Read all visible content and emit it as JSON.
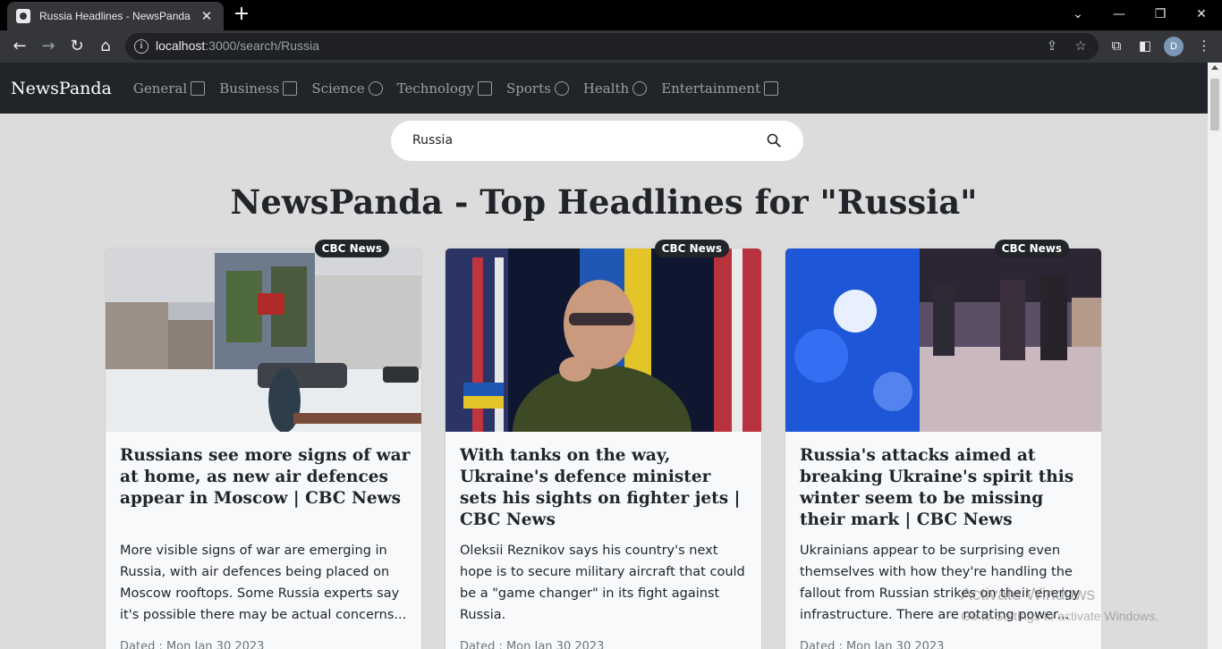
{
  "browser": {
    "tab_title": "Russia Headlines - NewsPanda",
    "url_host": "localhost",
    "url_rest": ":3000/search/Russia",
    "profile_initial": "D"
  },
  "navbar": {
    "brand": "NewsPanda",
    "links": [
      {
        "label": "General",
        "icon": "newspaper-icon"
      },
      {
        "label": "Business",
        "icon": "briefcase-icon"
      },
      {
        "label": "Science",
        "icon": "rocket-icon"
      },
      {
        "label": "Technology",
        "icon": "cpu-icon"
      },
      {
        "label": "Sports",
        "icon": "trophy-icon"
      },
      {
        "label": "Health",
        "icon": "lungs-icon"
      },
      {
        "label": "Entertainment",
        "icon": "film-icon"
      }
    ]
  },
  "search": {
    "value": "Russia",
    "icon": "search-icon"
  },
  "heading": "NewsPanda - Top Headlines for \"Russia\"",
  "cards": [
    {
      "source": "CBC News",
      "title": "Russians see more signs of war at home, as new air defences appear in Moscow | CBC News",
      "description": "More visible signs of war are emerging in Russia, with air defences being placed on Moscow rooftops. Some Russia experts say it's possible there may be actual concerns...",
      "date": "Dated : Mon Jan 30 2023"
    },
    {
      "source": "CBC News",
      "title": "With tanks on the way, Ukraine's defence minister sets his sights on fighter jets | CBC News",
      "description": "Oleksii Reznikov says his country's next hope is to secure military aircraft that could be a \"game changer\" in its fight against Russia.",
      "date": "Dated : Mon Jan 30 2023"
    },
    {
      "source": "CBC News",
      "title": "Russia's attacks aimed at breaking Ukraine's spirit this winter seem to be missing their mark | CBC News",
      "description": "Ukrainians appear to be surprising even themselves with how they're handling the fallout from Russian strikes on their energy infrastructure. There are rotating power...",
      "date": "Dated : Mon Jan 30 2023"
    }
  ],
  "watermark": {
    "line1": "Activate Windows",
    "line2": "Go to Settings to activate Windows."
  }
}
